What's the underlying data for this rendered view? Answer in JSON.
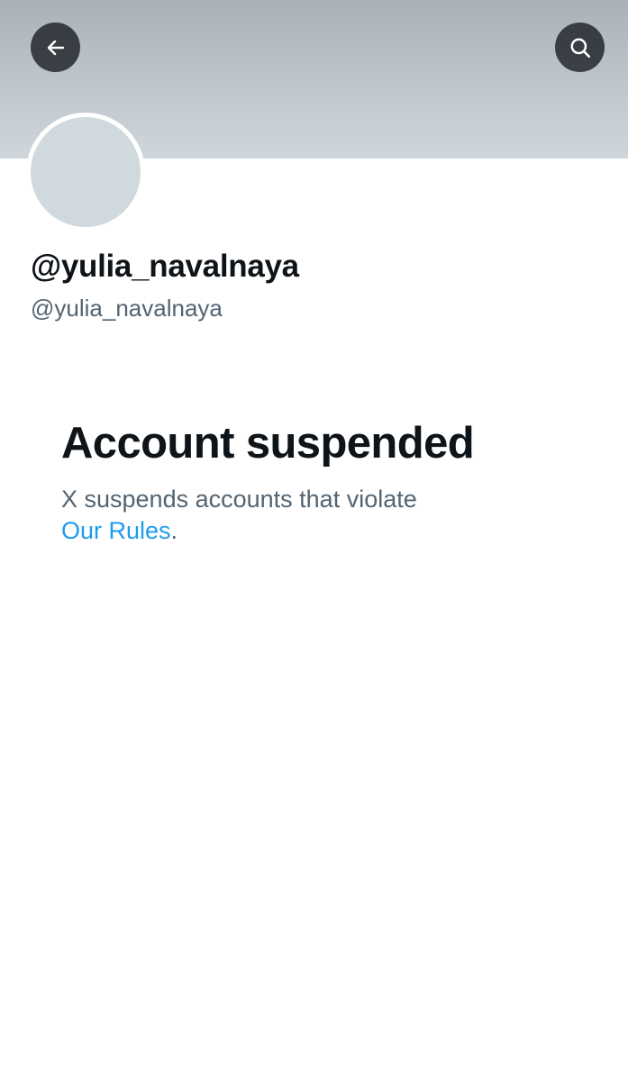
{
  "header": {
    "back_icon": "arrow-left-icon",
    "search_icon": "search-icon",
    "icon_button_bg": "#0f1419",
    "banner_color": "#c4cbd1"
  },
  "profile": {
    "display_name": "@yulia_navalnaya",
    "handle": "@yulia_navalnaya",
    "avatar_color": "#cfd9de"
  },
  "suspension": {
    "title": "Account suspended",
    "message": "X suspends accounts that violate",
    "link_label": "Our Rules",
    "trailing_punctuation": ".",
    "link_color": "#1d9bf0"
  }
}
